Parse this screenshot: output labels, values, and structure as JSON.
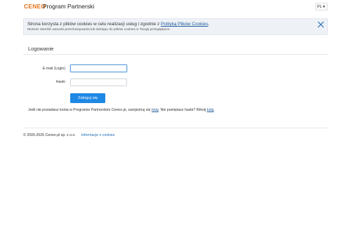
{
  "header": {
    "logo_text": "CENEO",
    "app_title": "Program Partnerski",
    "language": "PL",
    "brand_color": "#e8731a"
  },
  "cookie_notice": {
    "text_before_link": "Strona korzysta z plików cookies w celu realizacji usług i zgodnie z ",
    "link_text": "Polityką Plików Cookies",
    "text_after_link": ".",
    "note": "Możesz określić warunki przechowywania lub dostępu do plików cookies w Twojej przeglądarce.",
    "close_icon": "close-icon"
  },
  "login": {
    "title": "Logowanie",
    "email_label": "E-mail (Login)",
    "email_value": "",
    "password_label": "Hasło",
    "password_value": "",
    "submit_label": "Zaloguj się",
    "submit_color": "#1e88e5",
    "register_before": "Jeśli nie posiadasz konta w Programie Partnerskim Ceneo.pl, zarejestruj się ",
    "register_link": "tutaj",
    "register_middle": ". Nie pamiętasz hasła? Kliknij ",
    "forgot_link": "tutaj",
    "register_after": "."
  },
  "footer": {
    "copyright": "© 2005-2026 Ceneo.pl sp. z o.o.",
    "cookies_link": "Informacje o cookies"
  }
}
